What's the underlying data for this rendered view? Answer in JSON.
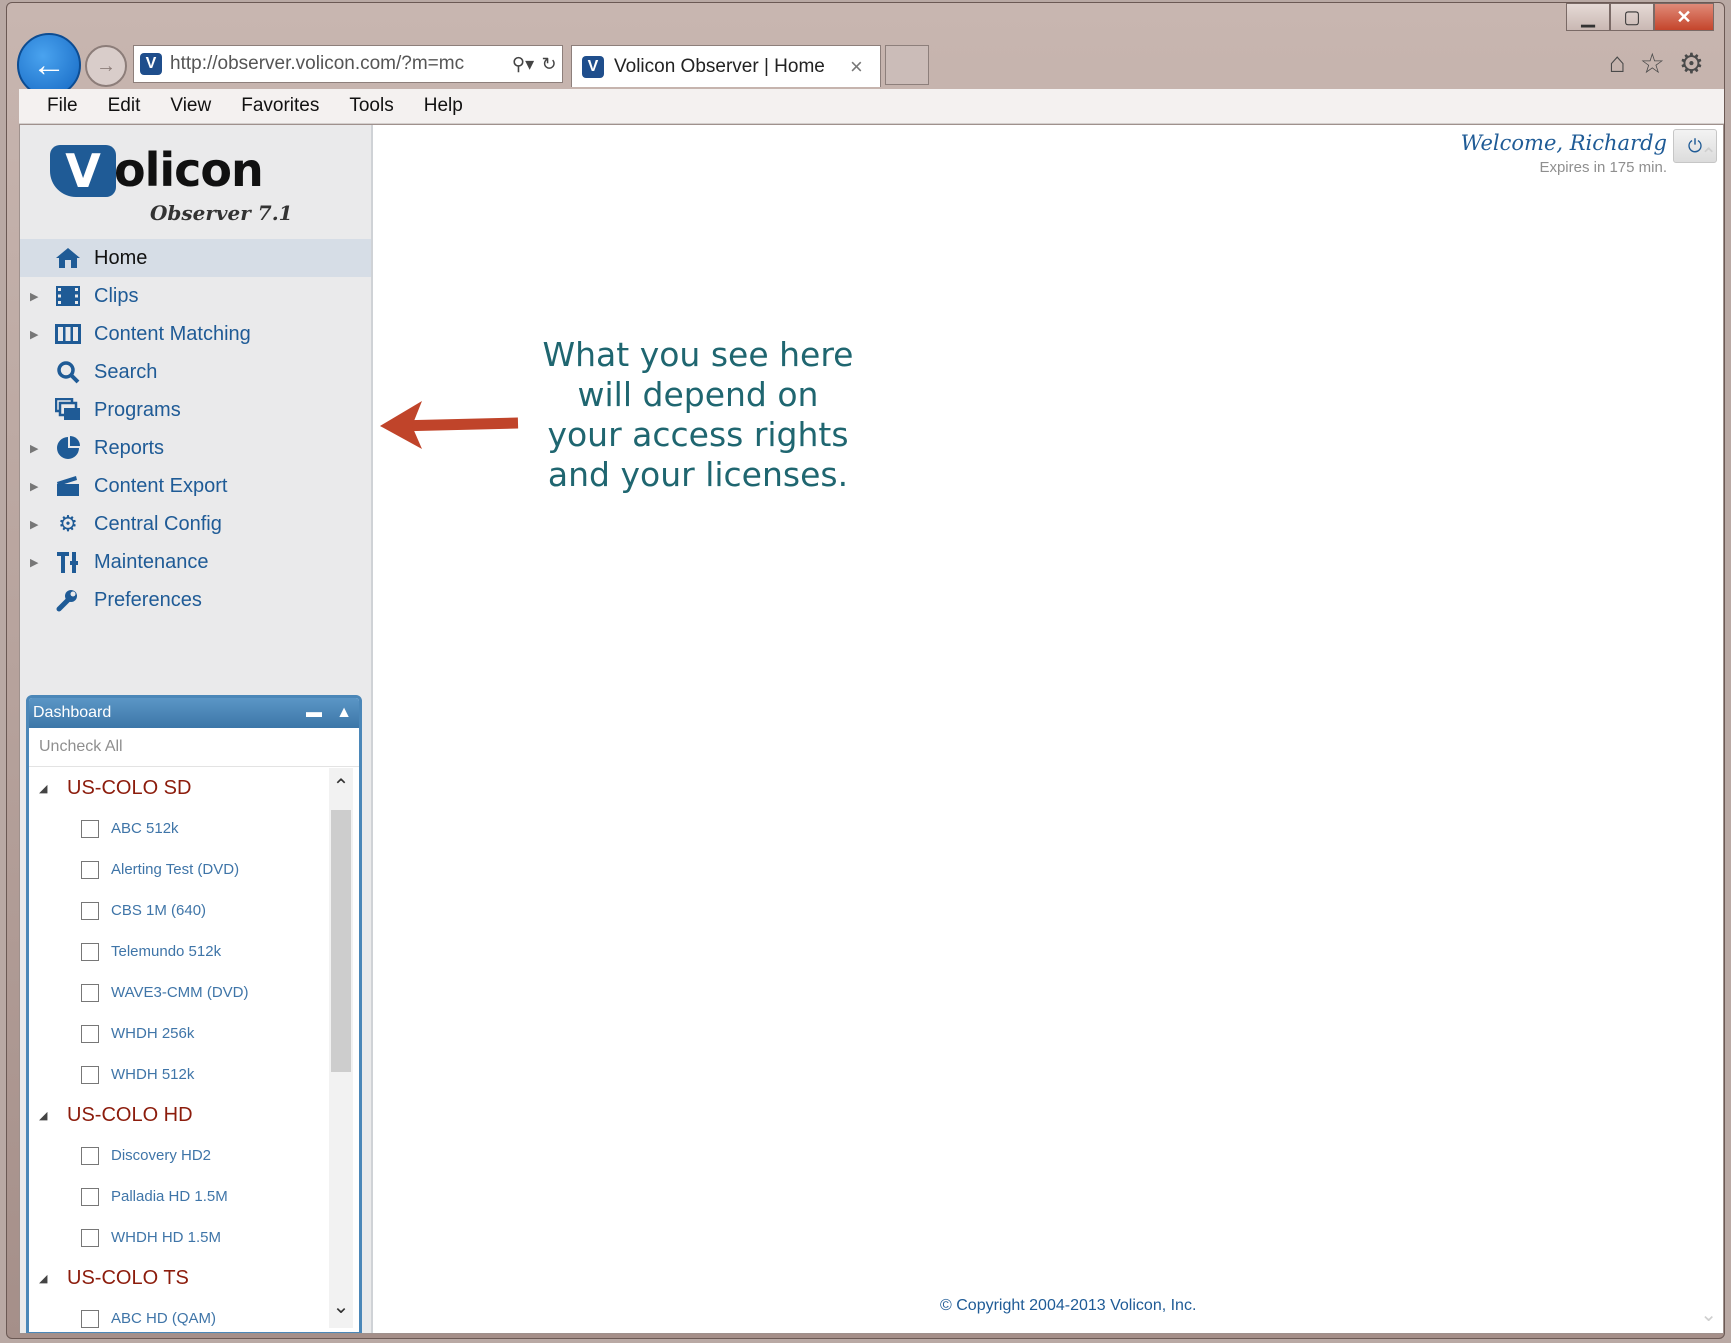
{
  "browser": {
    "url": "http://observer.volicon.com/?m=mc",
    "tab_title": "Volicon Observer | Home",
    "favicon_letter": "V",
    "window_controls": {
      "minimize": "▁",
      "maximize": "▢",
      "close": "✕"
    }
  },
  "menubar": [
    "File",
    "Edit",
    "View",
    "Favorites",
    "Tools",
    "Help"
  ],
  "logo": {
    "mark": "V",
    "text": "olicon",
    "subtitle": "Observer 7.1"
  },
  "nav": [
    {
      "label": "Home",
      "icon": "home-icon",
      "active": true,
      "expandable": false
    },
    {
      "label": "Clips",
      "icon": "film-icon",
      "active": false,
      "expandable": true
    },
    {
      "label": "Content Matching",
      "icon": "content-matching-icon",
      "active": false,
      "expandable": true
    },
    {
      "label": "Search",
      "icon": "search-icon",
      "active": false,
      "expandable": false
    },
    {
      "label": "Programs",
      "icon": "programs-icon",
      "active": false,
      "expandable": false
    },
    {
      "label": "Reports",
      "icon": "pie-chart-icon",
      "active": false,
      "expandable": true
    },
    {
      "label": "Content Export",
      "icon": "clapper-icon",
      "active": false,
      "expandable": true
    },
    {
      "label": "Central Config",
      "icon": "gear-icon",
      "active": false,
      "expandable": true
    },
    {
      "label": "Maintenance",
      "icon": "tools-icon",
      "active": false,
      "expandable": true
    },
    {
      "label": "Preferences",
      "icon": "wrench-icon",
      "active": false,
      "expandable": false
    }
  ],
  "dashboard": {
    "title": "Dashboard",
    "uncheck_all": "Uncheck All",
    "groups": [
      {
        "name": "US-COLO SD",
        "channels": [
          "ABC 512k",
          "Alerting Test (DVD)",
          "CBS 1M (640)",
          "Telemundo 512k",
          "WAVE3-CMM (DVD)",
          "WHDH 256k",
          "WHDH 512k"
        ]
      },
      {
        "name": "US-COLO HD",
        "channels": [
          "Discovery HD2",
          "Palladia HD 1.5M",
          "WHDH HD 1.5M"
        ]
      },
      {
        "name": "US-COLO TS",
        "channels": [
          "ABC HD (QAM)"
        ]
      }
    ]
  },
  "header": {
    "welcome": "Welcome, Richardg",
    "expires": "Expires in 175 min."
  },
  "annotation": "What you see here will depend on your access rights and your licenses.",
  "footer": {
    "copyright": "© Copyright 2004-2013 Volicon, Inc."
  },
  "colors": {
    "accent": "#1f5b96",
    "group_red": "#8c1c0c",
    "annotation_teal": "#1f6670",
    "arrow_red": "#c0442a"
  }
}
